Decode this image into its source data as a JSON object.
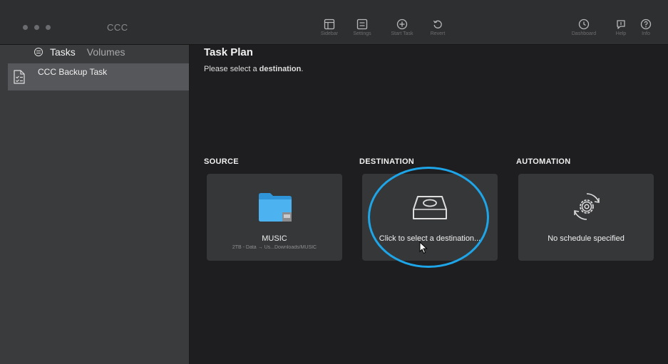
{
  "window": {
    "title": "CCC"
  },
  "toolbar": {
    "buttons": [
      {
        "label": "Sidebar",
        "icon": "sidebar-icon"
      },
      {
        "label": "Settings",
        "icon": "settings-icon"
      },
      {
        "label": "Start Task",
        "icon": "start-task-icon"
      },
      {
        "label": "Revert",
        "icon": "revert-icon"
      },
      {
        "label": "Dashboard",
        "icon": "dashboard-icon"
      },
      {
        "label": "Help",
        "icon": "help-bubble-icon"
      },
      {
        "label": "Info",
        "icon": "info-icon"
      }
    ]
  },
  "sidebar": {
    "tabs": [
      {
        "label": "Tasks",
        "active": true
      },
      {
        "label": "Volumes",
        "active": false
      }
    ],
    "tasks": [
      {
        "label": "CCC Backup Task",
        "selected": true
      }
    ]
  },
  "main": {
    "title": "Task Plan",
    "subtitle_prefix": "Please select a",
    "subtitle_bold": "destination",
    "subtitle_suffix": ".",
    "sections": {
      "source": {
        "label": "SOURCE",
        "name": "MUSIC",
        "path": "2TB - Data → Us...Downloads/MUSIC",
        "icon": "folder-icon"
      },
      "destination": {
        "label": "DESTINATION",
        "text": "Click to select a destination...",
        "icon": "drive-icon"
      },
      "automation": {
        "label": "AUTOMATION",
        "text": "No schedule specified",
        "icon": "schedule-gear-icon"
      }
    }
  },
  "colors": {
    "highlight_ring": "#1ea5e8",
    "folder": "#3aa7ea",
    "card_bg": "#363739",
    "sidebar_bg": "#3a3b3d"
  }
}
